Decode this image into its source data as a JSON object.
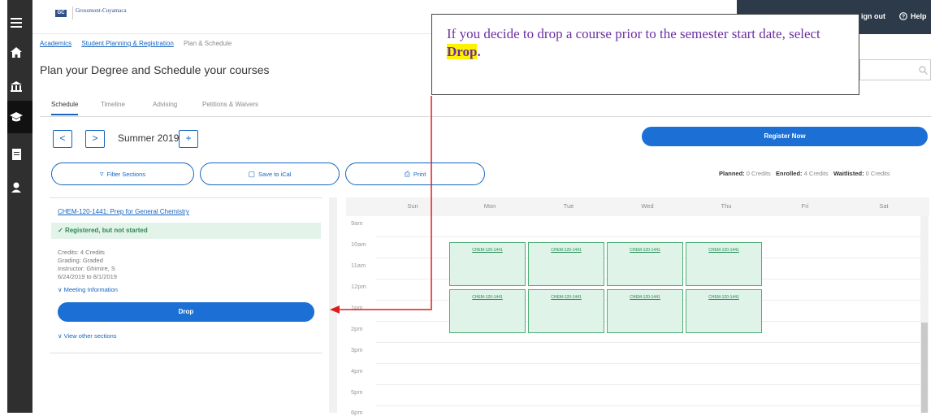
{
  "header": {
    "logo_badge": "GC",
    "logo_text": "Grossmont-Cuyamaca",
    "sign_out": "ign out",
    "help": "Help"
  },
  "breadcrumb": [
    "Academics",
    "Student Planning & Registration",
    "Plan & Schedule"
  ],
  "page_title": "Plan your Degree and Schedule your courses",
  "tabs": [
    "Schedule",
    "Timeline",
    "Advising",
    "Petitions & Waivers"
  ],
  "term": {
    "prev": "<",
    "next": ">",
    "label": "Summer 2019",
    "add": "+"
  },
  "actions": {
    "register": "Register Now",
    "filter": "Filter Sections",
    "save_ical": "Save to iCal",
    "print": "Print"
  },
  "credits": {
    "planned_label": "Planned:",
    "planned_value": "0 Credits",
    "enrolled_label": "Enrolled:",
    "enrolled_value": "4 Credits",
    "waitlisted_label": "Waitlisted:",
    "waitlisted_value": "0 Credits"
  },
  "course": {
    "title": "CHEM-120-1441: Prep for General Chemistry",
    "status": "Registered, but not started",
    "credits": "Credits: 4 Credits",
    "grading": "Grading: Graded",
    "instructor": "Instructor: Ghimire, S",
    "dates": "6/24/2019 to 8/1/2019",
    "meeting_info": "Meeting Information",
    "drop": "Drop",
    "view_other": "View other sections"
  },
  "calendar": {
    "days": [
      "Sun",
      "Mon",
      "Tue",
      "Wed",
      "Thu",
      "Fri",
      "Sat"
    ],
    "hours": [
      "9am",
      "10am",
      "11am",
      "12pm",
      "1pm",
      "2pm",
      "3pm",
      "4pm",
      "5pm",
      "6pm"
    ],
    "event_label": "CHEM-120-1441"
  },
  "callout": {
    "text": "If you decide to drop a course prior to the semester start date, select",
    "highlight": "Drop",
    "end": "."
  },
  "colors": {
    "primary": "#1c6fd4",
    "success": "#2f8a53",
    "callout_text": "#6a2fa0",
    "arrow": "#e01b1b"
  }
}
